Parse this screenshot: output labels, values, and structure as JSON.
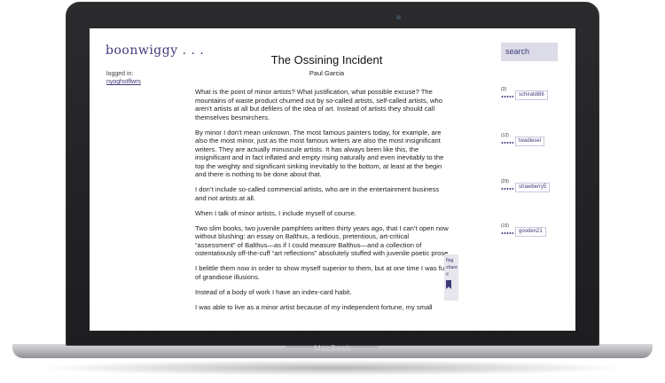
{
  "device": {
    "brand": "MacBook"
  },
  "site": {
    "logo": "boonwiggy . . .",
    "logged_in_label": "logged in:",
    "username": "nyoghstflwrs",
    "search_label": "search"
  },
  "article": {
    "title": "The Ossining Incident",
    "author": "Paul Garcia",
    "paragraphs": [
      "What is the point of minor artists? What justification, what possible excuse? The mountains of waste product churned out by so-called artists, self-called artists, who aren’t artists at all but defilers of the idea of art. Instead of artists they should call themselves besmirchers.",
      "By minor I don’t mean unknown. The most famous painters today, for example, are also the most minor, just as the most famous writers are also the most insignificant writers. They are actually minuscule artists. It has always been like this, the insignificant and in fact inflated and empty rising naturally and even inevitably to the top the weighty and significant sinking inevitably to the bottom, at least at the begin and there is nothing to be done about that.",
      "I don’t include so-called commercial artists, who are in the entertainment business and not artists at all.",
      "When I talk of minor artists, I include myself of course.",
      "Two slim books, two juvenile pamphlets written thirty years ago, that I can’t open now without blushing: an essay on Balthus, a tedious, pretentious, art-critical “assessment” of Balthus—as if I could measure Balthus—and a collection of ostentatiously off-the-cuff “art reflections” absolutely stuffed with juvenile poetic prose.",
      "I belittle them now in order to show myself superior to them, but at one time I was full of grandiose illusions.",
      "Instead of a body of work I have an index-card habit.",
      "I was able to live as a minor artist because of my independent fortune, my small"
    ]
  },
  "actions": {
    "flag": "flag",
    "share": "share",
    "hash": "#"
  },
  "notes": [
    {
      "count": "(3)",
      "user": "schiraldi86"
    },
    {
      "count": "(12)",
      "user": "twadiesel"
    },
    {
      "count": "(29)",
      "user": "strawberry5"
    },
    {
      "count": "(15)",
      "user": "gooden21"
    }
  ]
}
